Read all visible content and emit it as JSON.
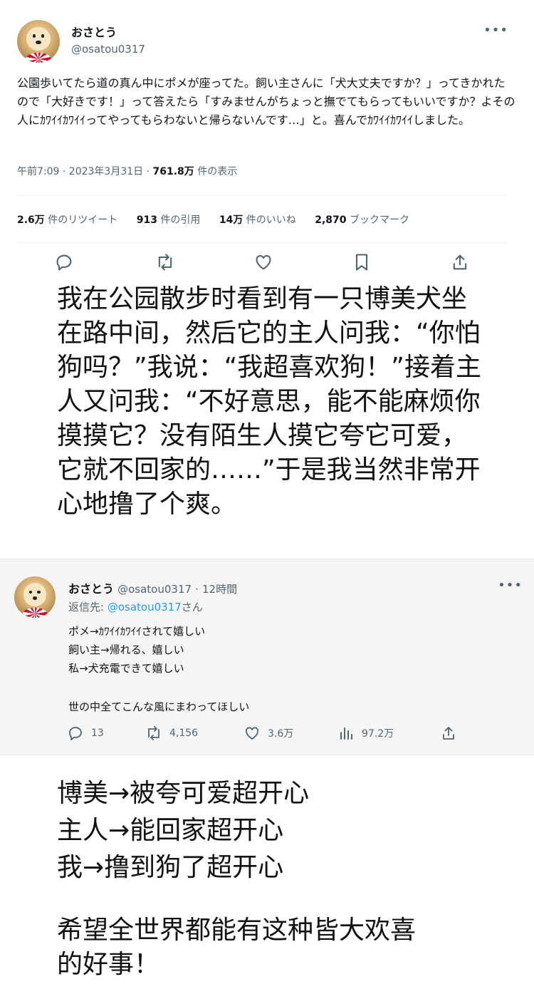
{
  "tweet": {
    "author_name": "おさとう",
    "author_handle": "@osatou0317",
    "more_icon": "more-dots-icon",
    "text": "公園歩いてたら道の真ん中にポメが座ってた。飼い主さんに「犬大丈夫ですか？」ってきかれたので「大好きです！」って答えたら「すみませんがちょっと撫でてもらってもいいですか？よその人にｶﾜｲｲｶﾜｲｲってやってもらわないと帰らないんです…」と。喜んでｶﾜｲｲｶﾜｲｲしました。",
    "meta_prefix": "午前7:09 · 2023年3月31日 · ",
    "views": "761.8万",
    "views_suffix": " 件の表示",
    "stats": [
      {
        "value": "2.6万",
        "label": " 件のリツイート"
      },
      {
        "value": "913",
        "label": " 件の引用"
      },
      {
        "value": "14万",
        "label": " 件のいいね"
      },
      {
        "value": "2,870",
        "label": " ブックマーク"
      }
    ],
    "actions": [
      "reply-icon",
      "retweet-icon",
      "like-icon",
      "bookmark-icon",
      "share-icon"
    ]
  },
  "translation_1": "我在公园散步时看到有一只博美犬坐在路中间，然后它的主人问我：“你怕狗吗？”我说：“我超喜欢狗！”接着主人又问我：“不好意思，能不能麻烦你摸摸它？没有陌生人摸它夸它可爱，它就不回家的……”于是我当然非常开心地撸了个爽。",
  "reply": {
    "author_name": "おさとう",
    "author_handle": "@osatou0317",
    "time": "12時間",
    "reply_prefix": "返信先: ",
    "reply_mention": "@osatou0317",
    "reply_suffix": "さん",
    "lines": [
      "ポメ→ｶﾜｲｲｶﾜｲｲされて嬉しい",
      "飼い主→帰れる、嬉しい",
      "私→犬充電できて嬉しい",
      "世の中全てこんな風にまわってほしい"
    ],
    "counts": {
      "replies": "13",
      "retweets": "4,156",
      "likes": "3.6万",
      "views": "97.2万"
    }
  },
  "translation_2": {
    "lines": [
      "博美→被夸可爱超开心",
      "主人→能回家超开心",
      "我→撸到狗了超开心"
    ],
    "closing": [
      "希望全世界都能有这种皆大欢喜",
      "的好事！"
    ]
  }
}
